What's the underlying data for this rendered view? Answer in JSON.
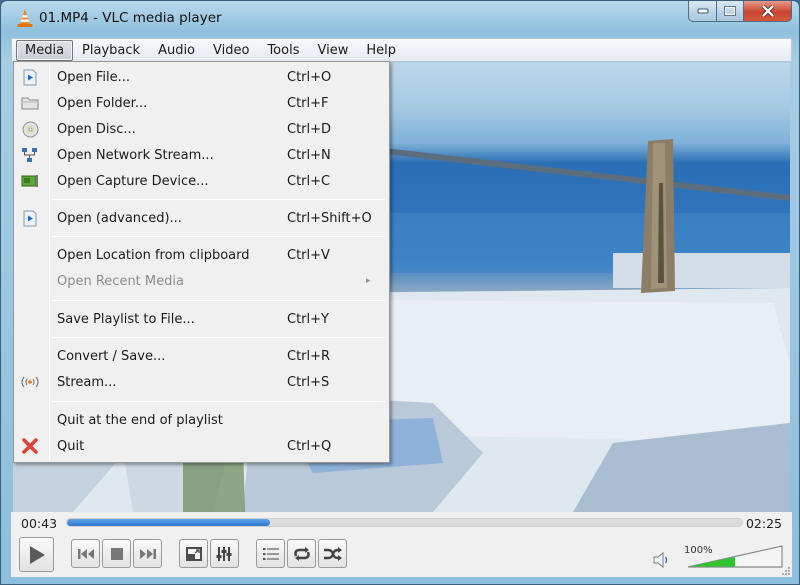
{
  "window": {
    "title": "01.MP4 - VLC media player",
    "app_icon": "vlc-cone-icon",
    "buttons": {
      "minimize": "minimize-icon",
      "maximize": "maximize-icon",
      "close": "close-icon"
    }
  },
  "menubar": {
    "items": [
      {
        "label": "Media",
        "active": true
      },
      {
        "label": "Playback",
        "active": false
      },
      {
        "label": "Audio",
        "active": false
      },
      {
        "label": "Video",
        "active": false
      },
      {
        "label": "Tools",
        "active": false
      },
      {
        "label": "View",
        "active": false
      },
      {
        "label": "Help",
        "active": false
      }
    ]
  },
  "media_menu": {
    "items": [
      {
        "label": "Open File...",
        "shortcut": "Ctrl+O",
        "icon": "open-file-icon",
        "enabled": true
      },
      {
        "label": "Open Folder...",
        "shortcut": "Ctrl+F",
        "icon": "folder-icon",
        "enabled": true
      },
      {
        "label": "Open Disc...",
        "shortcut": "Ctrl+D",
        "icon": "disc-icon",
        "enabled": true
      },
      {
        "label": "Open Network Stream...",
        "shortcut": "Ctrl+N",
        "icon": "network-icon",
        "enabled": true
      },
      {
        "label": "Open Capture Device...",
        "shortcut": "Ctrl+C",
        "icon": "capture-card-icon",
        "enabled": true
      },
      {
        "label": "Open (advanced)...",
        "shortcut": "Ctrl+Shift+O",
        "icon": "open-file-icon",
        "enabled": true
      },
      {
        "label": "Open Location from clipboard",
        "shortcut": "Ctrl+V",
        "icon": "",
        "enabled": true
      },
      {
        "label": "Open Recent Media",
        "shortcut": "",
        "icon": "",
        "enabled": false,
        "submenu": true
      },
      {
        "label": "Save Playlist to File...",
        "shortcut": "Ctrl+Y",
        "icon": "",
        "enabled": true
      },
      {
        "label": "Convert / Save...",
        "shortcut": "Ctrl+R",
        "icon": "",
        "enabled": true
      },
      {
        "label": "Stream...",
        "shortcut": "Ctrl+S",
        "icon": "stream-icon",
        "enabled": true
      },
      {
        "label": "Quit at the end of playlist",
        "shortcut": "",
        "icon": "",
        "enabled": true
      },
      {
        "label": "Quit",
        "shortcut": "Ctrl+Q",
        "icon": "quit-icon",
        "enabled": true
      }
    ],
    "submenu_arrow": "▸"
  },
  "player": {
    "current_time": "00:43",
    "total_time": "02:25",
    "progress_fraction": 0.3,
    "volume_label": "100%",
    "volume_fraction": 0.5
  },
  "colors": {
    "progress": "#2b78cf",
    "volume": "#2ec52e",
    "quit_x": "#e0413a"
  }
}
